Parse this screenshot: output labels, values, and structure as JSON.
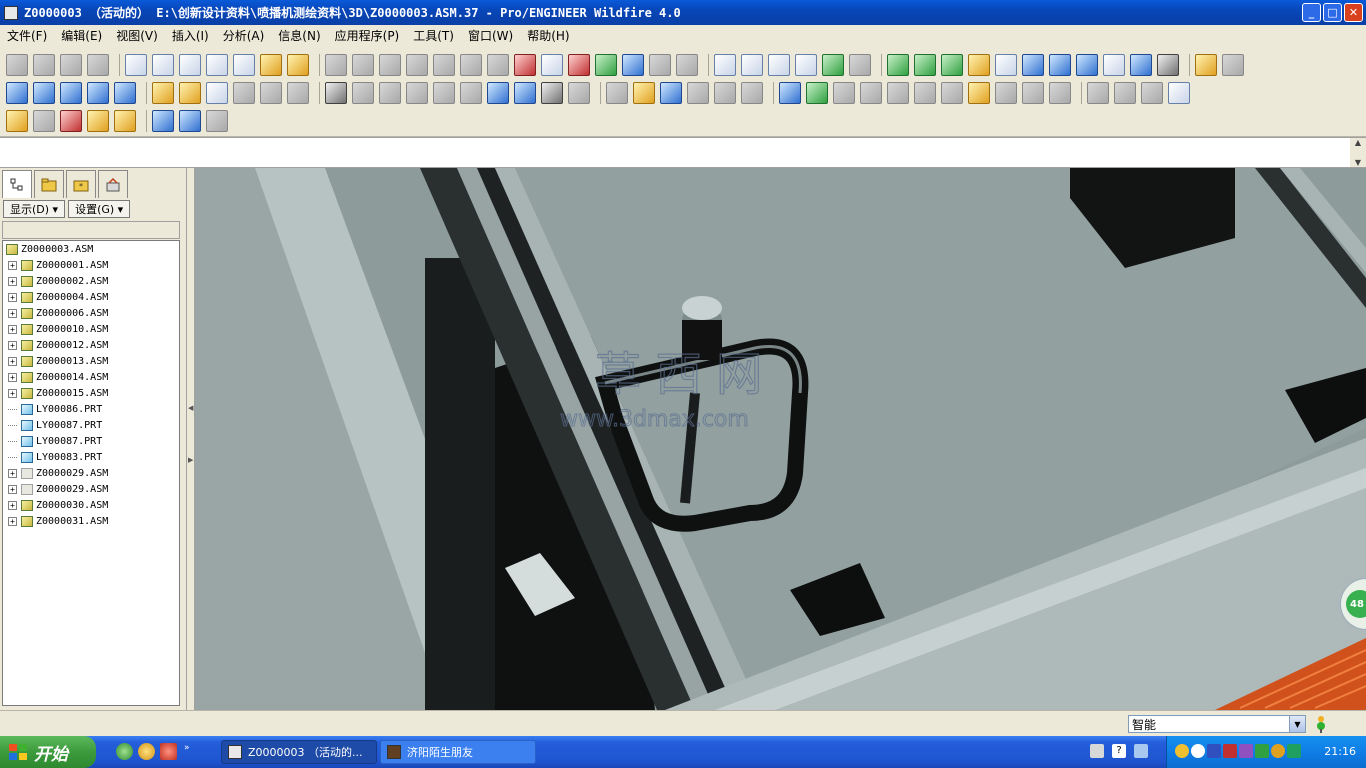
{
  "window": {
    "title": "Z0000003 （活动的） E:\\创新设计资料\\喷播机测绘资料\\3D\\Z0000003.ASM.37 - Pro/ENGINEER Wildfire 4.0",
    "controls": {
      "minimize": "_",
      "maximize": "□",
      "close": "✕"
    }
  },
  "menubar": {
    "items": [
      "文件(F)",
      "编辑(E)",
      "视图(V)",
      "插入(I)",
      "分析(A)",
      "信息(N)",
      "应用程序(P)",
      "工具(T)",
      "窗口(W)",
      "帮助(H)"
    ]
  },
  "panel": {
    "show_button": "显示(D) ▾",
    "settings_button": "设置(G) ▾"
  },
  "model_tree": {
    "root": "Z0000003.ASM",
    "items": [
      {
        "label": "Z0000001.ASM",
        "type": "asm"
      },
      {
        "label": "Z0000002.ASM",
        "type": "asm"
      },
      {
        "label": "Z0000004.ASM",
        "type": "asm"
      },
      {
        "label": "Z0000006.ASM",
        "type": "asm"
      },
      {
        "label": "Z0000010.ASM",
        "type": "asm"
      },
      {
        "label": "Z0000012.ASM",
        "type": "asm"
      },
      {
        "label": "Z0000013.ASM",
        "type": "asm"
      },
      {
        "label": "Z0000014.ASM",
        "type": "asm"
      },
      {
        "label": "Z0000015.ASM",
        "type": "asm"
      },
      {
        "label": "LY00086.PRT",
        "type": "prt"
      },
      {
        "label": "LY00087.PRT",
        "type": "prt"
      },
      {
        "label": "LY00087.PRT",
        "type": "prt"
      },
      {
        "label": "LY00083.PRT",
        "type": "prt"
      },
      {
        "label": "Z0000029.ASM",
        "type": "ghost"
      },
      {
        "label": "Z0000029.ASM",
        "type": "ghost"
      },
      {
        "label": "Z0000030.ASM",
        "type": "asm"
      },
      {
        "label": "Z0000031.ASM",
        "type": "asm"
      }
    ]
  },
  "watermark": {
    "text": "草 西 网",
    "url": "www.3dmax.com"
  },
  "viewport": {
    "side_badge": "48"
  },
  "status": {
    "filter_value": "智能"
  },
  "taskbar": {
    "start_label": "开始",
    "tasks": [
      {
        "label": "Z0000003 （活动的...",
        "active": true
      },
      {
        "label": "济阳陌生朋友",
        "active": false
      }
    ],
    "clock": "21:16"
  }
}
